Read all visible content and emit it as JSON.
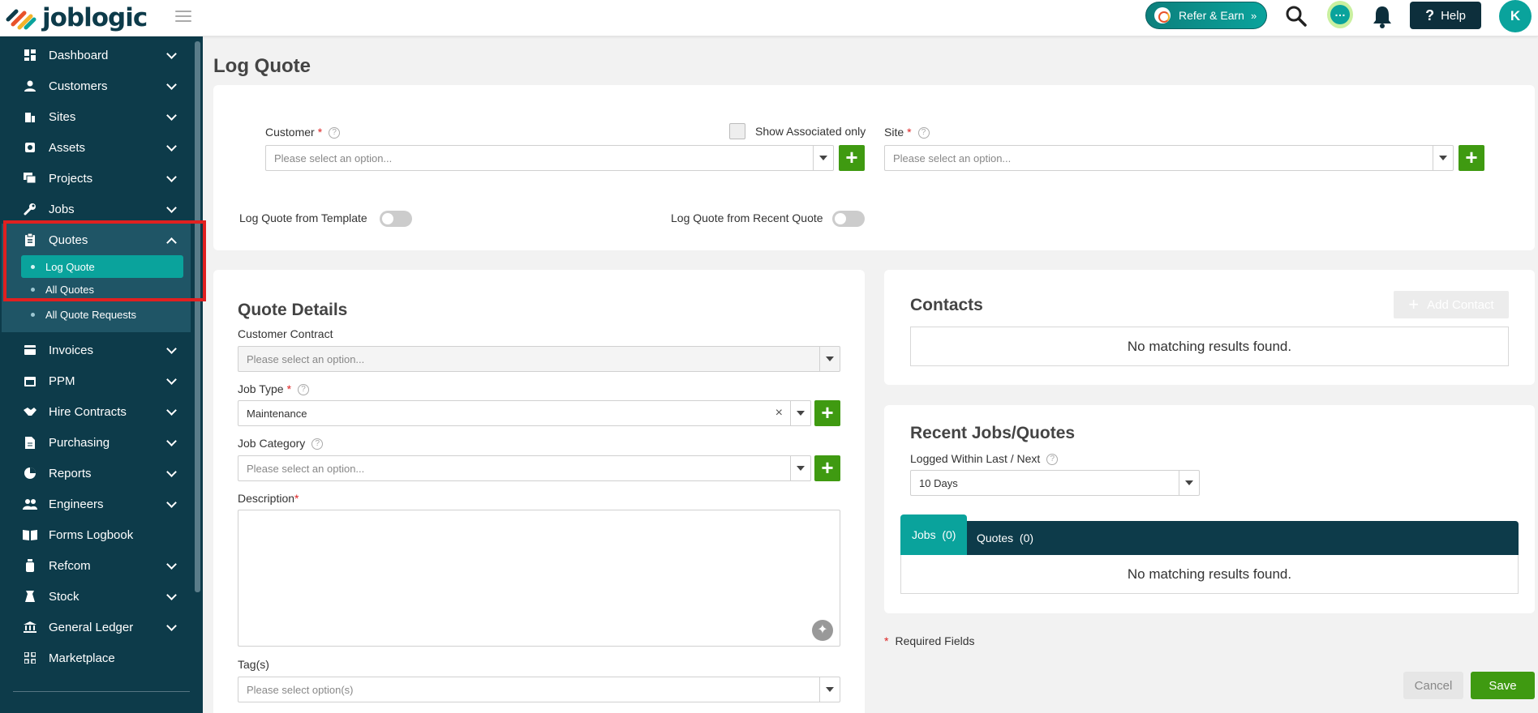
{
  "app": {
    "logo_text": "joblogic"
  },
  "topbar": {
    "refer_label": "Refer & Earn",
    "help_label": "Help",
    "avatar_initial": "K"
  },
  "sidebar": {
    "items": [
      {
        "label": "Dashboard"
      },
      {
        "label": "Customers"
      },
      {
        "label": "Sites"
      },
      {
        "label": "Assets"
      },
      {
        "label": "Projects"
      },
      {
        "label": "Jobs"
      },
      {
        "label": "Quotes"
      },
      {
        "label": "Invoices"
      },
      {
        "label": "PPM"
      },
      {
        "label": "Hire Contracts"
      },
      {
        "label": "Purchasing"
      },
      {
        "label": "Reports"
      },
      {
        "label": "Engineers"
      },
      {
        "label": "Forms Logbook"
      },
      {
        "label": "Refcom"
      },
      {
        "label": "Stock"
      },
      {
        "label": "General Ledger"
      },
      {
        "label": "Marketplace"
      }
    ],
    "quotes_sub": [
      {
        "label": "Log Quote"
      },
      {
        "label": "All Quotes"
      },
      {
        "label": "All Quote Requests"
      }
    ]
  },
  "page": {
    "title": "Log Quote"
  },
  "top_card": {
    "customer_label": "Customer",
    "show_associated_label": "Show Associated only",
    "customer_placeholder": "Please select an option...",
    "site_label": "Site",
    "site_placeholder": "Please select an option...",
    "template_toggle_label": "Log Quote from Template",
    "recent_toggle_label": "Log Quote from Recent Quote"
  },
  "quote_details": {
    "title": "Quote Details",
    "contract_label": "Customer Contract",
    "contract_placeholder": "Please select an option...",
    "job_type_label": "Job Type",
    "job_type_value": "Maintenance",
    "job_category_label": "Job Category",
    "job_category_placeholder": "Please select an option...",
    "description_label": "Description",
    "tags_label": "Tag(s)",
    "tags_placeholder": "Please select option(s)"
  },
  "contacts": {
    "title": "Contacts",
    "add_label": "Add Contact",
    "empty_text": "No matching results found."
  },
  "recent": {
    "title": "Recent Jobs/Quotes",
    "logged_label": "Logged Within Last / Next",
    "logged_value": "10 Days",
    "tab_jobs": "Jobs",
    "tab_jobs_count": "(0)",
    "tab_quotes": "Quotes",
    "tab_quotes_count": "(0)",
    "empty_text": "No matching results found."
  },
  "footer": {
    "required_text": "Required Fields",
    "cancel_label": "Cancel",
    "save_label": "Save"
  },
  "colors": {
    "sidebar_bg": "#0d3b4a",
    "accent": "#0aa39c",
    "add_green": "#3f9a11",
    "highlight_red": "#e02020"
  }
}
